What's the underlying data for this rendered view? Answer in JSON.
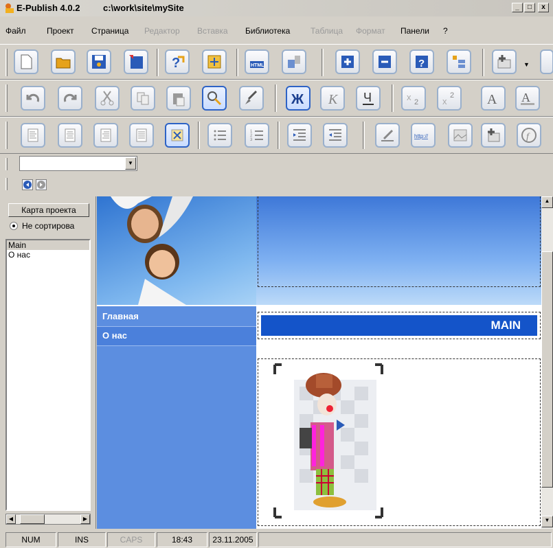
{
  "window": {
    "app_title": "E-Publish 4.0.2",
    "path": "c:\\work\\site\\mySite"
  },
  "menu": [
    "Файл",
    "Проект",
    "Страница",
    "Редактор",
    "Вставка",
    "Библиотека",
    "Таблица",
    "Формат",
    "Панели",
    "?"
  ],
  "menu_disabled": [
    "Редактор",
    "Вставка",
    "Таблица",
    "Формат"
  ],
  "left_panel": {
    "project_map_button": "Карта проекта",
    "sort_option": "Не сортирова",
    "tree_items": [
      "Main",
      "О нас"
    ]
  },
  "toolbar3": {
    "link_button_label": "http://"
  },
  "page": {
    "nav_items": [
      "Главная",
      "О нас"
    ],
    "heading": "MAIN"
  },
  "status": {
    "num": "NUM",
    "ins": "INS",
    "caps": "CAPS",
    "time": "18:43",
    "date": "23.11.2005"
  },
  "icons": [
    "new-document-icon",
    "open-folder-icon",
    "save-icon",
    "save-as-icon",
    "help-arrow-icon",
    "insert-object-icon",
    "html-icon",
    "publish-icon",
    "add-page-icon",
    "remove-page-icon",
    "help-icon",
    "page-tree-icon",
    "add-table-icon",
    "undo-icon",
    "redo-icon",
    "cut-icon",
    "copy-icon",
    "paste-icon",
    "find-icon",
    "brush-icon",
    "bold-icon",
    "italic-icon",
    "underline-icon",
    "subscript-icon",
    "superscript-icon",
    "font-color-icon",
    "font-highlight-icon",
    "align-left-icon",
    "align-center-icon",
    "align-right-icon",
    "justify-icon",
    "image-icon",
    "bullet-list-icon",
    "numbered-list-icon",
    "indent-icon",
    "outdent-icon",
    "edit-icon",
    "link-icon",
    "image-map-icon",
    "insert-table-icon",
    "function-icon",
    "back-icon",
    "forward-icon"
  ],
  "colors": {
    "header_blue": "#3e78d8",
    "sidebar_blue": "#5c8ee0",
    "main_bar": "#1454c9"
  }
}
